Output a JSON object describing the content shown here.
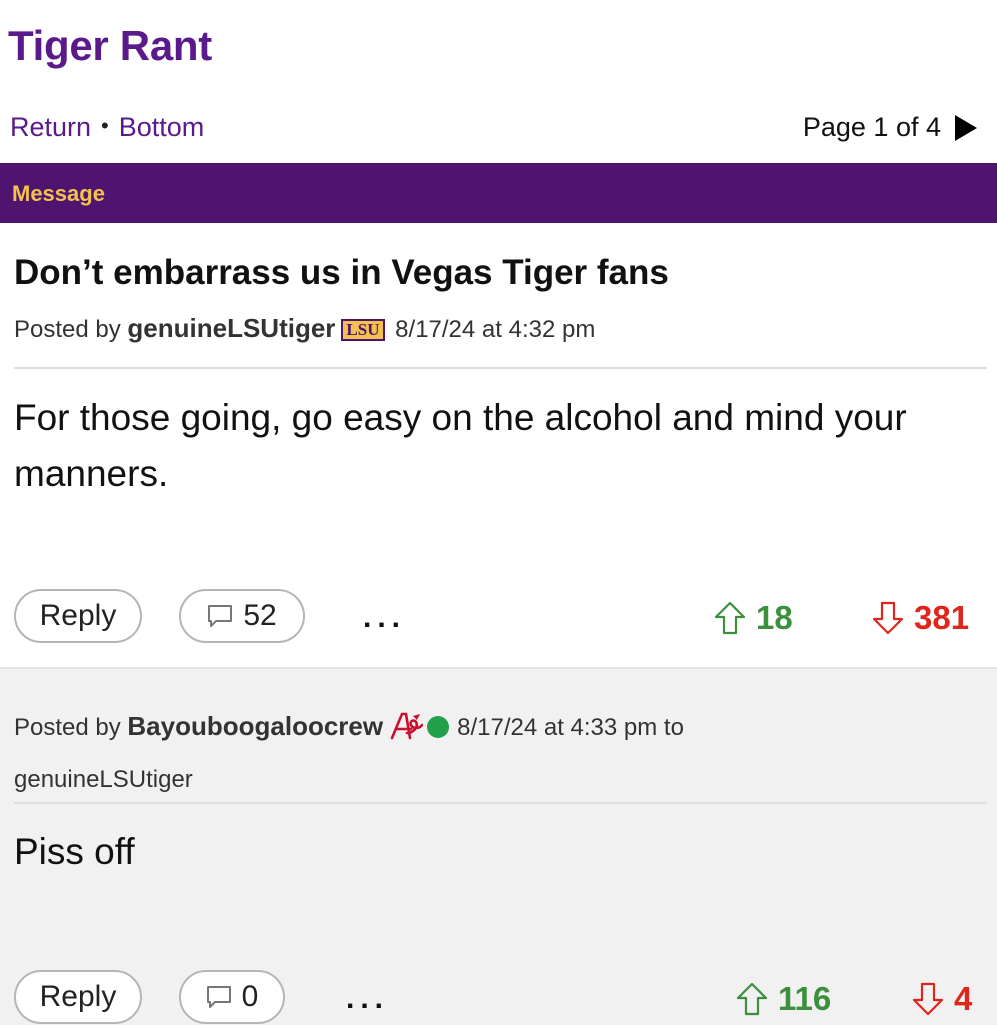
{
  "board": {
    "title": "Tiger Rant"
  },
  "nav": {
    "return_label": "Return",
    "separator": "•",
    "bottom_label": "Bottom",
    "page_label": "Page 1 of 4"
  },
  "message_bar": {
    "label": "Message"
  },
  "thread": {
    "title": "Don’t embarrass us in Vegas Tiger fans",
    "posted_by_label": "Posted by",
    "author": "genuineLSUtiger",
    "author_badge": "LSU",
    "timestamp": "8/17/24 at 4:32 pm",
    "body": "For those going, go easy on the alcohol and mind your manners.",
    "reply_label": "Reply",
    "comment_count": "52",
    "more_label": "...",
    "upvotes": "18",
    "downvotes": "381"
  },
  "reply": {
    "posted_by_label": "Posted by",
    "author": "Bayouboogaloocrew",
    "author_badge_icon": "braves-logo-icon",
    "status": "online",
    "timestamp": "8/17/24 at 4:33 pm to",
    "reply_to": "genuineLSUtiger",
    "body": "Piss off",
    "reply_label": "Reply",
    "comment_count": "0",
    "more_label": "...",
    "upvotes": "116",
    "downvotes": "4"
  },
  "colors": {
    "brand_purple": "#4e1470",
    "link_purple": "#5b1a8c",
    "gold": "#f2c14e",
    "upvote_green": "#3c8f3c",
    "downvote_red": "#e0261b",
    "online_green": "#23a04a"
  }
}
